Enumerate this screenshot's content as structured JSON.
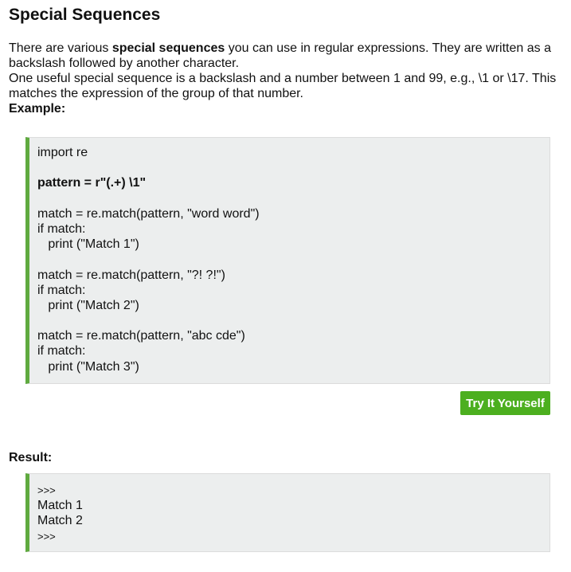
{
  "title": "Special Sequences",
  "intro": {
    "p1_before": "There are various ",
    "p1_strong": "special sequences",
    "p1_after": " you can use in regular expressions. They are written as a backslash followed by another character.",
    "p2": "One useful special sequence is a backslash and a number between 1 and 99, e.g., \\1 or \\17. This matches the expression of the group of that number.",
    "example_label": "Example:"
  },
  "example_code": [
    {
      "text": "import re",
      "bold": false
    },
    {
      "text": "",
      "bold": false
    },
    {
      "text": "pattern = r\"(.+) \\1\"",
      "bold": true
    },
    {
      "text": "",
      "bold": false
    },
    {
      "text": "match = re.match(pattern, \"word word\")",
      "bold": false
    },
    {
      "text": "if match:",
      "bold": false
    },
    {
      "text": "   print (\"Match 1\")",
      "bold": false
    },
    {
      "text": "",
      "bold": false
    },
    {
      "text": "match = re.match(pattern, \"?! ?!\")",
      "bold": false
    },
    {
      "text": "if match:",
      "bold": false
    },
    {
      "text": "   print (\"Match 2\")",
      "bold": false
    },
    {
      "text": "",
      "bold": false
    },
    {
      "text": "match = re.match(pattern, \"abc cde\")",
      "bold": false
    },
    {
      "text": "if match:",
      "bold": false
    },
    {
      "text": "   print (\"Match 3\")",
      "bold": false
    }
  ],
  "try_button_label": "Try It Yourself",
  "result_label": "Result:",
  "result_output": [
    {
      "text": ">>>",
      "small": true
    },
    {
      "text": "Match 1",
      "small": false
    },
    {
      "text": "Match 2",
      "small": false
    },
    {
      "text": ">>>",
      "small": true
    }
  ],
  "colors": {
    "accent_green": "#5faa3f",
    "button_green": "#4caf1f",
    "code_background": "#eceeee"
  }
}
